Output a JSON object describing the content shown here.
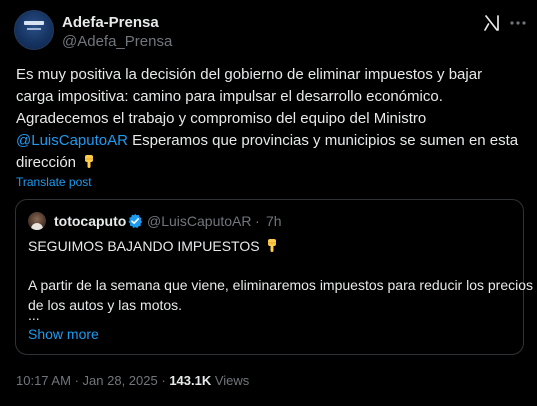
{
  "post": {
    "author": {
      "display_name": "Adefa-Prensa",
      "handle": "@Adefa_Prensa"
    },
    "text": {
      "line1": "Es muy positiva la decisión del gobierno de eliminar impuestos y bajar",
      "line2": "carga impositiva:  camino para impulsar el desarrollo económico.",
      "line3": "Agradecemos el trabajo y compromiso del equipo del Ministro",
      "mention": "@LuisCaputoAR",
      "line4_rest": " Esperamos que provincias y municipios se sumen en esta",
      "line5": "dirección"
    },
    "translate_label": "Translate post",
    "quote": {
      "display_name": "totocaputo",
      "handle": "@LuisCaputoAR",
      "separator": "·",
      "time": "7h",
      "headline": "SEGUIMOS BAJANDO IMPUESTOS",
      "body_line1": "A partir de la semana que viene, eliminaremos impuestos para reducir los precios",
      "body_line2": "de los autos y las motos.",
      "ellipsis": "...",
      "show_more_label": "Show more"
    },
    "meta": {
      "time": "10:17 AM",
      "separator": "·",
      "date": "Jan 28, 2025",
      "views_count": "143.1K",
      "views_label": "Views"
    },
    "icons": {
      "grok": "grok-icon",
      "more": "more-horizontal-icon",
      "verified": "verified-badge-icon",
      "emoji": "pointing-down-hand-emoji"
    },
    "colors": {
      "background": "#000000",
      "text": "#e7e9ea",
      "muted": "#71767b",
      "link": "#1d9bf0",
      "border": "#2f3336",
      "verified": "#1d9bf0",
      "emoji": "#ffcc4d"
    }
  }
}
